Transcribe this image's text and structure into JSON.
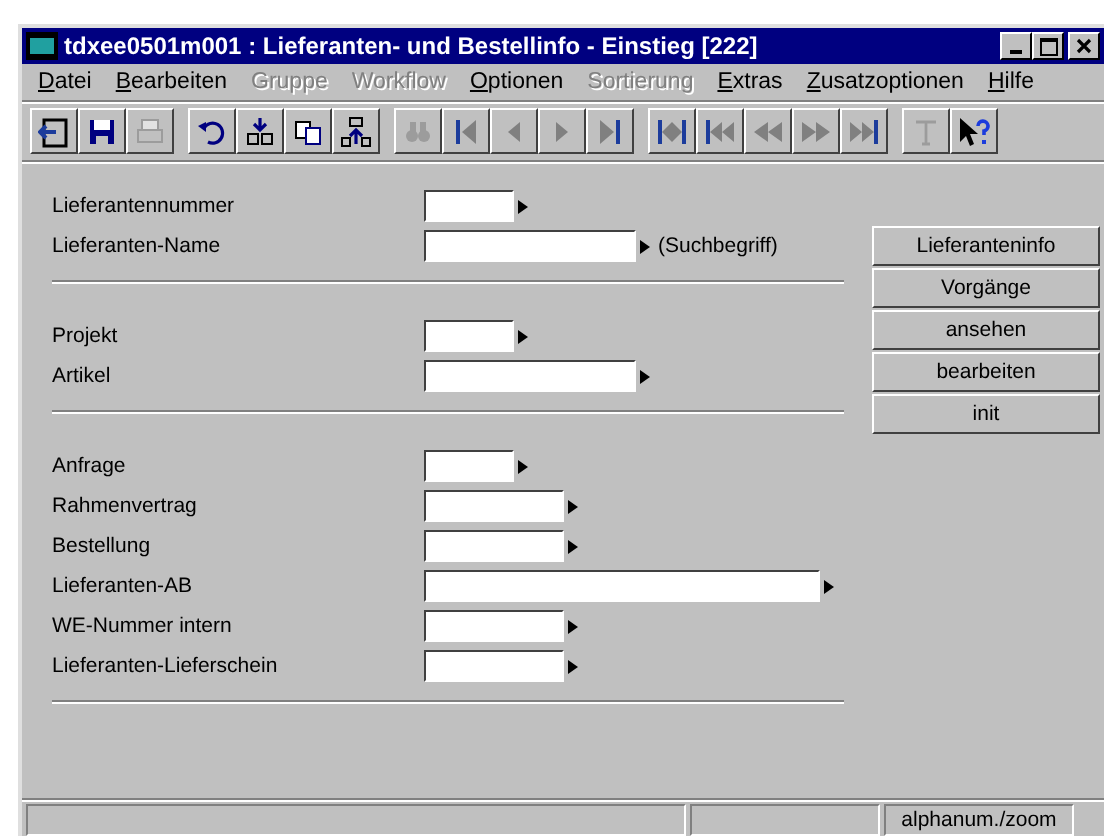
{
  "window": {
    "title": "tdxee0501m001 : Lieferanten- und Bestellinfo - Einstieg [222]"
  },
  "menu": [
    {
      "label": "Datei",
      "disabled": false
    },
    {
      "label": "Bearbeiten",
      "disabled": false
    },
    {
      "label": "Gruppe",
      "disabled": true
    },
    {
      "label": "Workflow",
      "disabled": true
    },
    {
      "label": "Optionen",
      "disabled": false
    },
    {
      "label": "Sortierung",
      "disabled": true
    },
    {
      "label": "Extras",
      "disabled": false
    },
    {
      "label": "Zusatzoptionen",
      "disabled": false
    },
    {
      "label": "Hilfe",
      "disabled": false
    }
  ],
  "toolbar": [
    [
      {
        "kind": "exit",
        "disabled": false
      },
      {
        "kind": "save",
        "disabled": false
      },
      {
        "kind": "print",
        "disabled": true
      }
    ],
    [
      {
        "kind": "undo",
        "disabled": false
      },
      {
        "kind": "insert",
        "disabled": false
      },
      {
        "kind": "copy",
        "disabled": false
      },
      {
        "kind": "append",
        "disabled": false
      }
    ],
    [
      {
        "kind": "find",
        "disabled": true
      },
      {
        "kind": "first",
        "disabled": false
      },
      {
        "kind": "prev",
        "disabled": false
      },
      {
        "kind": "next",
        "disabled": false
      },
      {
        "kind": "last",
        "disabled": false
      }
    ],
    [
      {
        "kind": "group-first",
        "disabled": false
      },
      {
        "kind": "page-first",
        "disabled": false
      },
      {
        "kind": "page-prev",
        "disabled": false
      },
      {
        "kind": "page-next",
        "disabled": false
      },
      {
        "kind": "page-last",
        "disabled": false
      }
    ],
    [
      {
        "kind": "text",
        "disabled": true
      },
      {
        "kind": "help",
        "disabled": false
      }
    ]
  ],
  "sections": [
    [
      {
        "label": "Lieferantennummer",
        "kind": "short"
      },
      {
        "label": "Lieferanten-Name",
        "kind": "medium",
        "suffix": "(Suchbegriff)"
      }
    ],
    [
      {
        "label": "Projekt",
        "kind": "short"
      },
      {
        "label": "Artikel",
        "kind": "medium"
      }
    ],
    [
      {
        "label": "Anfrage",
        "kind": "short"
      },
      {
        "label": "Rahmenvertrag",
        "kind": "small"
      },
      {
        "label": "Bestellung",
        "kind": "small"
      },
      {
        "label": "Lieferanten-AB",
        "kind": "wide"
      },
      {
        "label": "WE-Nummer intern",
        "kind": "small"
      },
      {
        "label": "Lieferanten-Lieferschein",
        "kind": "small"
      }
    ]
  ],
  "buttons": [
    "Lieferanteninfo",
    "Vorgänge",
    "ansehen",
    "bearbeiten",
    "init"
  ],
  "status_bar": {
    "mode": "alphanum./zoom"
  }
}
